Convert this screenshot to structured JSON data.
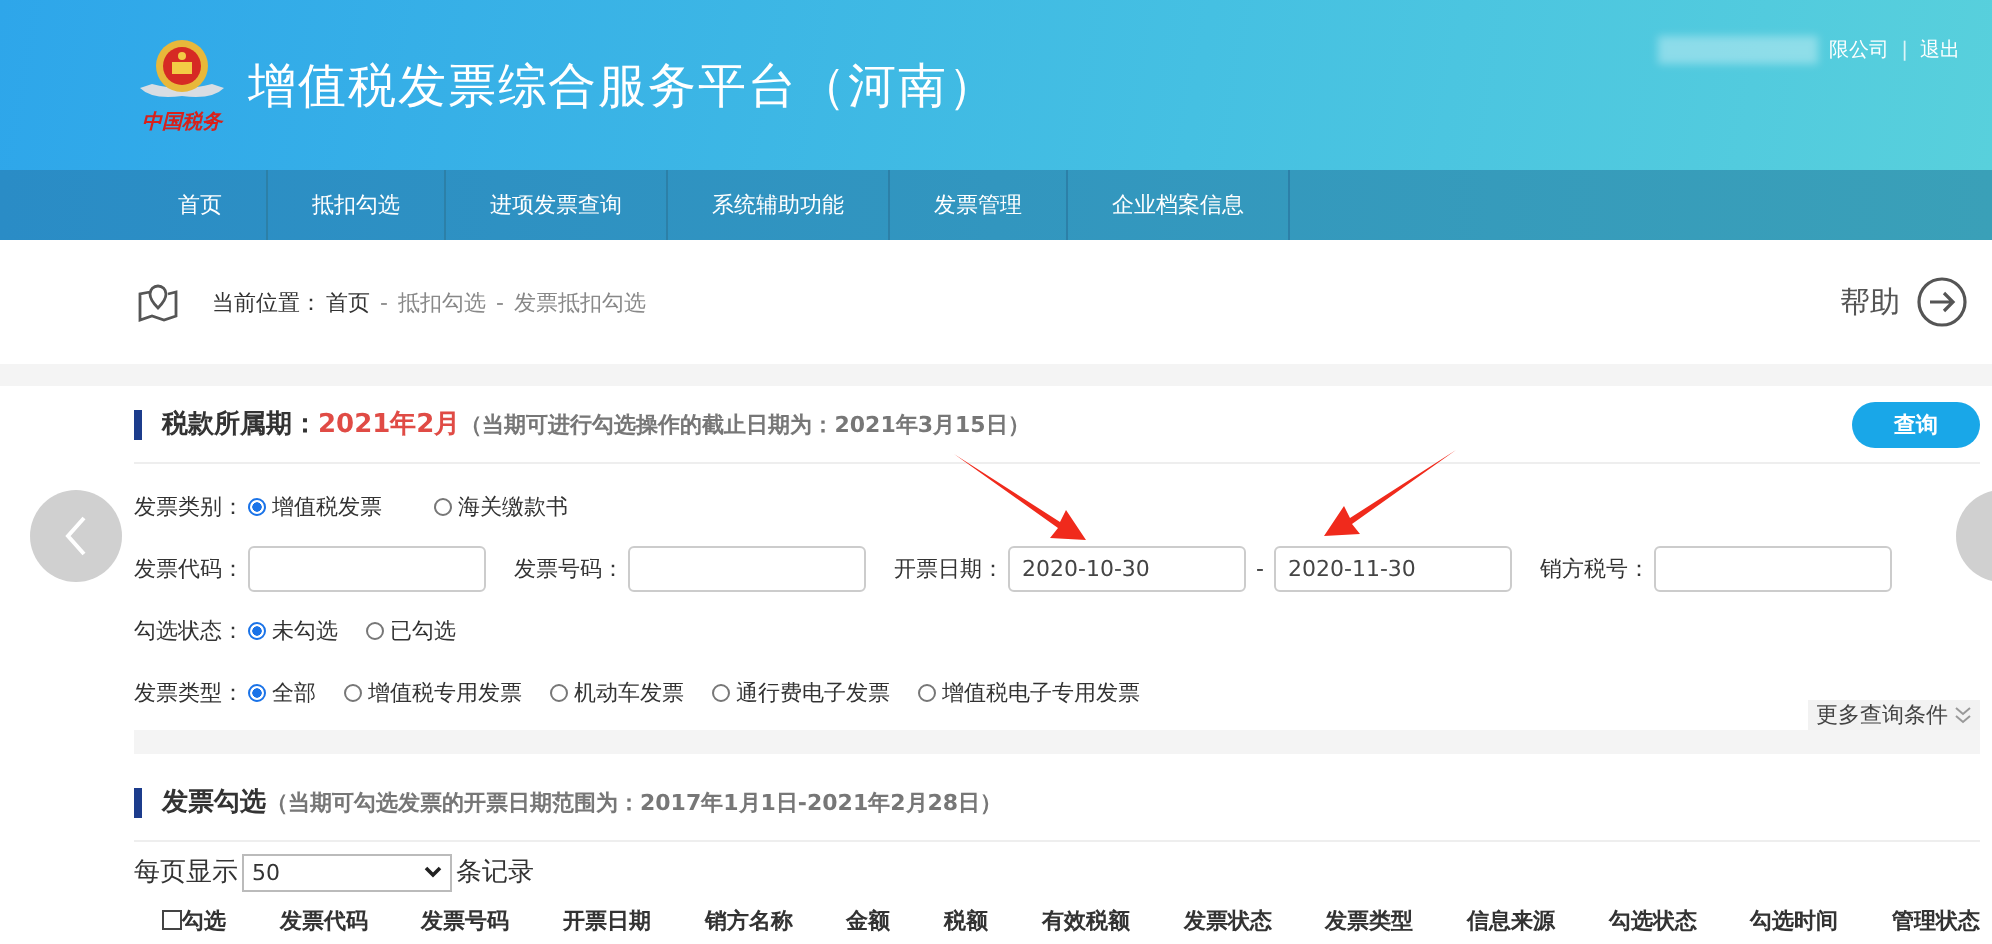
{
  "header": {
    "title": "增值税发票综合服务平台（河南）",
    "logo_caption": "中国税务",
    "user": {
      "company": "限公司",
      "separator": "|",
      "logout": "退出"
    }
  },
  "nav": {
    "items": [
      "首页",
      "抵扣勾选",
      "进项发票查询",
      "系统辅助功能",
      "发票管理",
      "企业档案信息"
    ]
  },
  "breadcrumb": {
    "prefix": "当前位置：",
    "items": [
      "首页",
      "抵扣勾选",
      "发票抵扣勾选"
    ],
    "separator": "-",
    "help": "帮助"
  },
  "period": {
    "label": "税款所属期：",
    "value": "2021年2月",
    "note": "（当期可进行勾选操作的截止日期为：2021年3月15日）",
    "query_button": "查询"
  },
  "invoice_category": {
    "label": "发票类别：",
    "options": [
      {
        "label": "增值税发票",
        "selected": true
      },
      {
        "label": "海关缴款书",
        "selected": false
      }
    ]
  },
  "fields": [
    {
      "label": "发票代码："
    },
    {
      "label": "发票号码："
    },
    {
      "label": "开票日期：",
      "value": "2020-10-30",
      "range_separator": "-",
      "value_end": "2020-11-30"
    },
    {
      "label": "销方税号："
    }
  ],
  "select_status": {
    "label": "勾选状态：",
    "options": [
      {
        "label": "未勾选",
        "selected": true
      },
      {
        "label": "已勾选",
        "selected": false
      }
    ]
  },
  "invoice_type": {
    "label": "发票类型：",
    "options": [
      {
        "label": "全部",
        "selected": true
      },
      {
        "label": "增值税专用发票",
        "selected": false
      },
      {
        "label": "机动车发票",
        "selected": false
      },
      {
        "label": "通行费电子发票",
        "selected": false
      },
      {
        "label": "增值税电子专用发票",
        "selected": false
      }
    ]
  },
  "more_conditions": "更多查询条件",
  "selection": {
    "title": "发票勾选",
    "note": "（当期可勾选发票的开票日期范围为：2017年1月1日-2021年2月28日）",
    "page_size": {
      "prefix": "每页显示",
      "value": "50",
      "suffix": "条记录"
    }
  },
  "table": {
    "select_all": {
      "label": "勾选",
      "checked": false
    },
    "columns": [
      "发票代码",
      "发票号码",
      "开票日期",
      "销方名称",
      "金额",
      "税额",
      "有效税额",
      "发票状态",
      "发票类型",
      "信息来源",
      "勾选状态",
      "勾选时间",
      "管理状态"
    ]
  }
}
